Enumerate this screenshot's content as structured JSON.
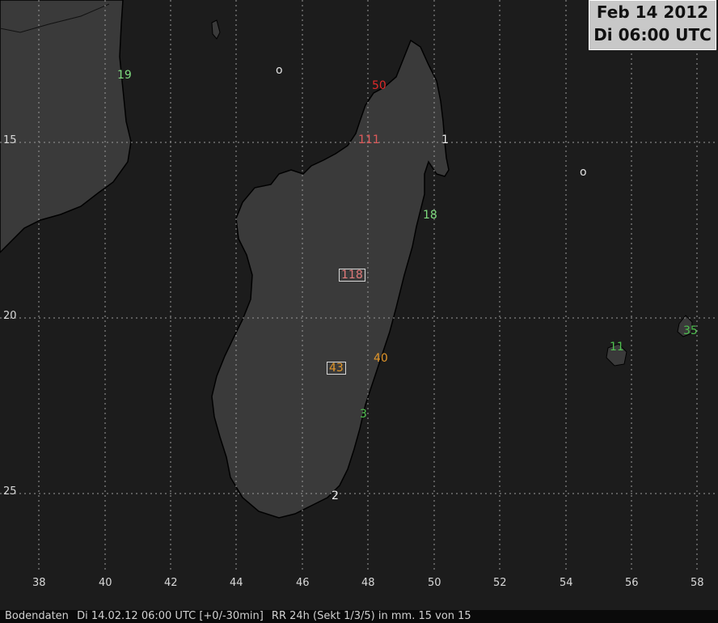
{
  "title": {
    "date": "Feb 14 2012",
    "time": "Di 06:00 UTC"
  },
  "status_bar": {
    "source": "Bodendaten",
    "timestamp": "Di 14.02.12 06:00 UTC [+0/-30min]",
    "product": "RR 24h (Sekt 1/3/5) in mm. 15 von 15"
  },
  "axes": {
    "lon_labels": [
      "38",
      "40",
      "42",
      "44",
      "46",
      "48",
      "50",
      "52",
      "54",
      "56",
      "58"
    ],
    "lat_labels": [
      "15",
      "20",
      "25"
    ]
  },
  "colors": {
    "land": "#3a3a3a",
    "sea": "#1c1c1c",
    "coast": "#000000",
    "grid": "#9a9a9a"
  },
  "observations": [
    {
      "value": "19",
      "color": "#7fdc7f",
      "boxed": false
    },
    {
      "value": "o",
      "color": "#e0e0e0",
      "boxed": false
    },
    {
      "value": "50",
      "color": "#e02a2a",
      "boxed": false
    },
    {
      "value": "111",
      "color": "#e05a5a",
      "boxed": false
    },
    {
      "value": "1",
      "color": "#f0f0f0",
      "boxed": false
    },
    {
      "value": "o",
      "color": "#e0e0e0",
      "boxed": false
    },
    {
      "value": "18",
      "color": "#7fdc7f",
      "boxed": false
    },
    {
      "value": "118",
      "color": "#e07a7a",
      "boxed": true
    },
    {
      "value": "40",
      "color": "#e0952a",
      "boxed": false
    },
    {
      "value": "43",
      "color": "#e0952a",
      "boxed": true
    },
    {
      "value": "11",
      "color": "#4fc04f",
      "boxed": false
    },
    {
      "value": "35",
      "color": "#4fc04f",
      "boxed": false
    },
    {
      "value": "3",
      "color": "#4fc04f",
      "boxed": false
    },
    {
      "value": "2",
      "color": "#f0f0f0",
      "boxed": false
    }
  ]
}
